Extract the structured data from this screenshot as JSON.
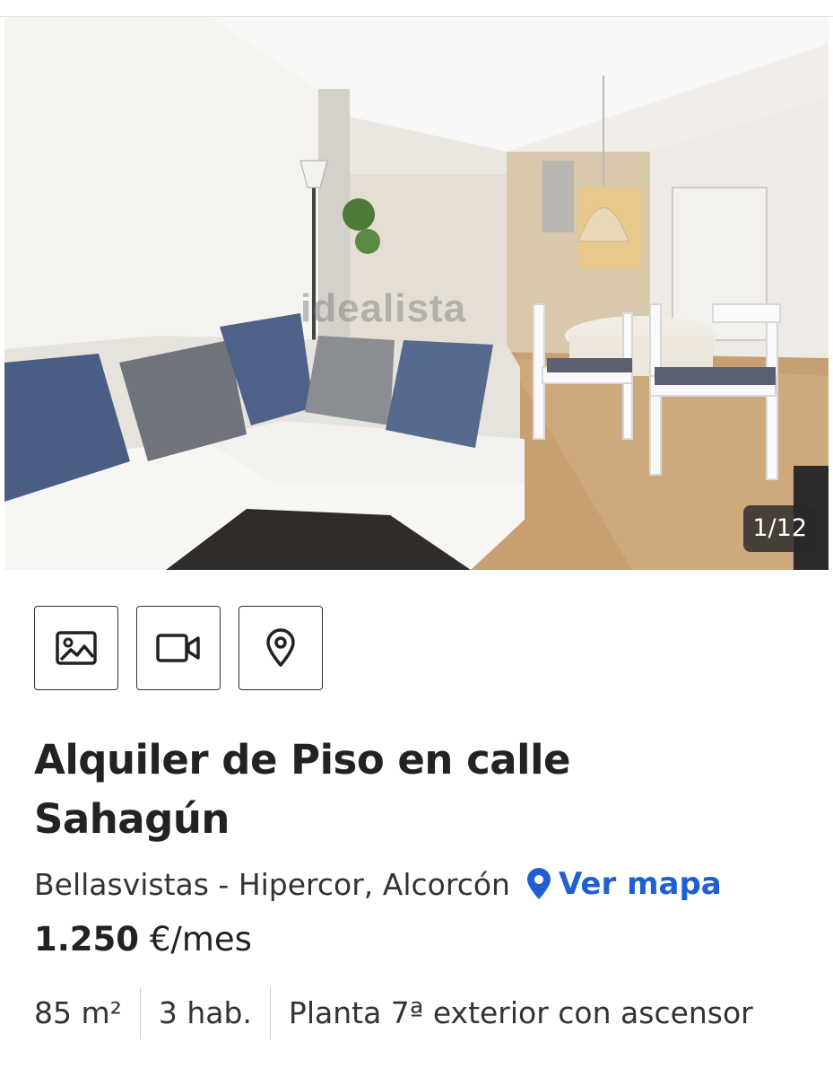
{
  "gallery": {
    "counter": "1/12",
    "watermark": "idealista"
  },
  "media_buttons": [
    {
      "icon": "image-icon"
    },
    {
      "icon": "video-icon"
    },
    {
      "icon": "map-pin-icon"
    }
  ],
  "listing": {
    "title": "Alquiler de Piso en calle Sahagún",
    "location": "Bellasvistas - Hipercor, Alcorcón",
    "map_link": "Ver mapa",
    "price_amount": "1.250",
    "price_unit": "€/mes",
    "features": [
      "85 m²",
      "3 hab.",
      "Planta 7ª exterior con ascensor"
    ]
  },
  "colors": {
    "link": "#1f5fd1",
    "text": "#222222"
  }
}
